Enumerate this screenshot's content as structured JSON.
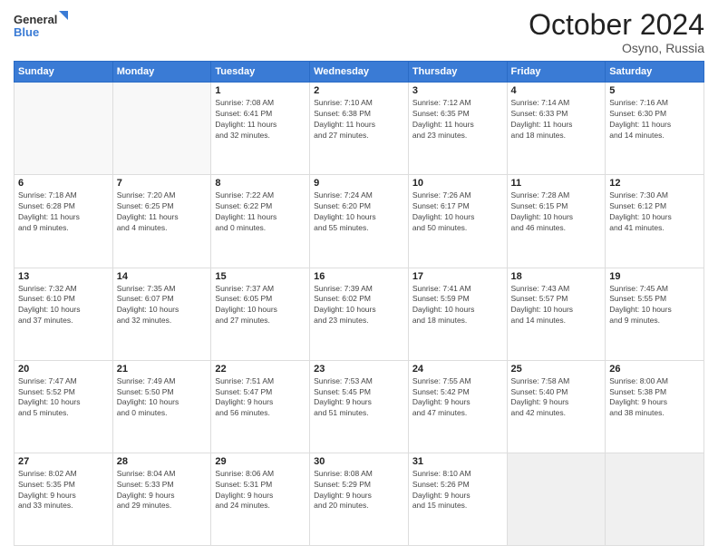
{
  "header": {
    "logo_line1": "General",
    "logo_line2": "Blue",
    "month": "October 2024",
    "location": "Osyno, Russia"
  },
  "weekdays": [
    "Sunday",
    "Monday",
    "Tuesday",
    "Wednesday",
    "Thursday",
    "Friday",
    "Saturday"
  ],
  "weeks": [
    [
      {
        "day": "",
        "info": ""
      },
      {
        "day": "",
        "info": ""
      },
      {
        "day": "1",
        "info": "Sunrise: 7:08 AM\nSunset: 6:41 PM\nDaylight: 11 hours\nand 32 minutes."
      },
      {
        "day": "2",
        "info": "Sunrise: 7:10 AM\nSunset: 6:38 PM\nDaylight: 11 hours\nand 27 minutes."
      },
      {
        "day": "3",
        "info": "Sunrise: 7:12 AM\nSunset: 6:35 PM\nDaylight: 11 hours\nand 23 minutes."
      },
      {
        "day": "4",
        "info": "Sunrise: 7:14 AM\nSunset: 6:33 PM\nDaylight: 11 hours\nand 18 minutes."
      },
      {
        "day": "5",
        "info": "Sunrise: 7:16 AM\nSunset: 6:30 PM\nDaylight: 11 hours\nand 14 minutes."
      }
    ],
    [
      {
        "day": "6",
        "info": "Sunrise: 7:18 AM\nSunset: 6:28 PM\nDaylight: 11 hours\nand 9 minutes."
      },
      {
        "day": "7",
        "info": "Sunrise: 7:20 AM\nSunset: 6:25 PM\nDaylight: 11 hours\nand 4 minutes."
      },
      {
        "day": "8",
        "info": "Sunrise: 7:22 AM\nSunset: 6:22 PM\nDaylight: 11 hours\nand 0 minutes."
      },
      {
        "day": "9",
        "info": "Sunrise: 7:24 AM\nSunset: 6:20 PM\nDaylight: 10 hours\nand 55 minutes."
      },
      {
        "day": "10",
        "info": "Sunrise: 7:26 AM\nSunset: 6:17 PM\nDaylight: 10 hours\nand 50 minutes."
      },
      {
        "day": "11",
        "info": "Sunrise: 7:28 AM\nSunset: 6:15 PM\nDaylight: 10 hours\nand 46 minutes."
      },
      {
        "day": "12",
        "info": "Sunrise: 7:30 AM\nSunset: 6:12 PM\nDaylight: 10 hours\nand 41 minutes."
      }
    ],
    [
      {
        "day": "13",
        "info": "Sunrise: 7:32 AM\nSunset: 6:10 PM\nDaylight: 10 hours\nand 37 minutes."
      },
      {
        "day": "14",
        "info": "Sunrise: 7:35 AM\nSunset: 6:07 PM\nDaylight: 10 hours\nand 32 minutes."
      },
      {
        "day": "15",
        "info": "Sunrise: 7:37 AM\nSunset: 6:05 PM\nDaylight: 10 hours\nand 27 minutes."
      },
      {
        "day": "16",
        "info": "Sunrise: 7:39 AM\nSunset: 6:02 PM\nDaylight: 10 hours\nand 23 minutes."
      },
      {
        "day": "17",
        "info": "Sunrise: 7:41 AM\nSunset: 5:59 PM\nDaylight: 10 hours\nand 18 minutes."
      },
      {
        "day": "18",
        "info": "Sunrise: 7:43 AM\nSunset: 5:57 PM\nDaylight: 10 hours\nand 14 minutes."
      },
      {
        "day": "19",
        "info": "Sunrise: 7:45 AM\nSunset: 5:55 PM\nDaylight: 10 hours\nand 9 minutes."
      }
    ],
    [
      {
        "day": "20",
        "info": "Sunrise: 7:47 AM\nSunset: 5:52 PM\nDaylight: 10 hours\nand 5 minutes."
      },
      {
        "day": "21",
        "info": "Sunrise: 7:49 AM\nSunset: 5:50 PM\nDaylight: 10 hours\nand 0 minutes."
      },
      {
        "day": "22",
        "info": "Sunrise: 7:51 AM\nSunset: 5:47 PM\nDaylight: 9 hours\nand 56 minutes."
      },
      {
        "day": "23",
        "info": "Sunrise: 7:53 AM\nSunset: 5:45 PM\nDaylight: 9 hours\nand 51 minutes."
      },
      {
        "day": "24",
        "info": "Sunrise: 7:55 AM\nSunset: 5:42 PM\nDaylight: 9 hours\nand 47 minutes."
      },
      {
        "day": "25",
        "info": "Sunrise: 7:58 AM\nSunset: 5:40 PM\nDaylight: 9 hours\nand 42 minutes."
      },
      {
        "day": "26",
        "info": "Sunrise: 8:00 AM\nSunset: 5:38 PM\nDaylight: 9 hours\nand 38 minutes."
      }
    ],
    [
      {
        "day": "27",
        "info": "Sunrise: 8:02 AM\nSunset: 5:35 PM\nDaylight: 9 hours\nand 33 minutes."
      },
      {
        "day": "28",
        "info": "Sunrise: 8:04 AM\nSunset: 5:33 PM\nDaylight: 9 hours\nand 29 minutes."
      },
      {
        "day": "29",
        "info": "Sunrise: 8:06 AM\nSunset: 5:31 PM\nDaylight: 9 hours\nand 24 minutes."
      },
      {
        "day": "30",
        "info": "Sunrise: 8:08 AM\nSunset: 5:29 PM\nDaylight: 9 hours\nand 20 minutes."
      },
      {
        "day": "31",
        "info": "Sunrise: 8:10 AM\nSunset: 5:26 PM\nDaylight: 9 hours\nand 15 minutes."
      },
      {
        "day": "",
        "info": ""
      },
      {
        "day": "",
        "info": ""
      }
    ]
  ]
}
